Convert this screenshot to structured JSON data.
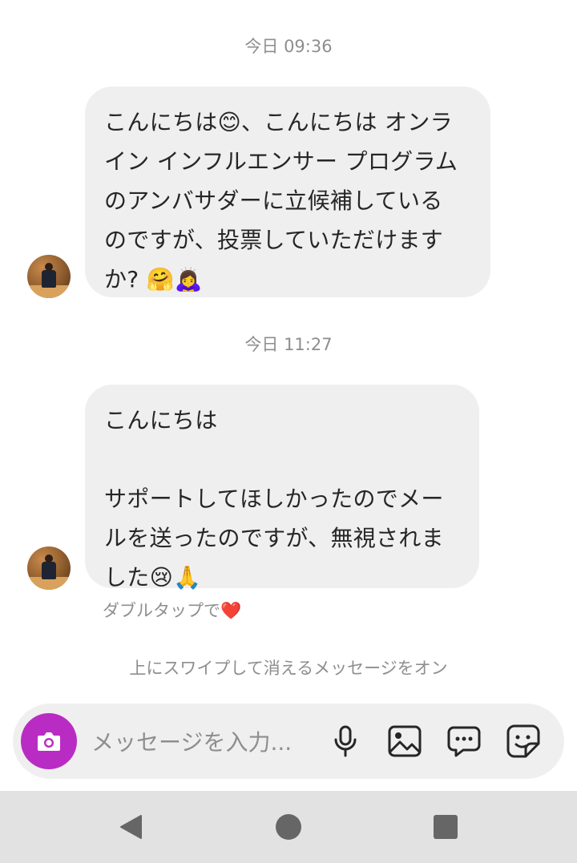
{
  "conversation": {
    "timestamps": [
      "今日 09:36",
      "今日 11:27"
    ],
    "messages": [
      {
        "lines": [
          "こんにちは😊、こんにちは オンラ",
          "イン インフルエンサー プログラム",
          "のアンバサダーに立候補している",
          "のですが、投票していただけます",
          "か? 🤗🙇‍♀️"
        ]
      },
      {
        "lines": [
          "こんにちは",
          "",
          "サポートしてほしかったのでメー",
          "ルを送ったのですが、無視されま",
          "した😢🙏"
        ]
      }
    ],
    "double_tap_hint": "ダブルタップで❤️",
    "vanish_mode_hint": "上にスワイプして消えるメッセージをオン"
  },
  "composer": {
    "placeholder": "メッセージを入力...",
    "icons": [
      "camera-icon",
      "microphone-icon",
      "gallery-icon",
      "chat-bubble-icon",
      "sticker-icon"
    ]
  },
  "navbar": {
    "icons": [
      "back-icon",
      "home-icon",
      "recents-icon"
    ]
  },
  "colors": {
    "bubble": "#efefef",
    "camera_button": "#b92cc4",
    "secondary_text": "#8e8e8e",
    "navbar": "#e2e2e2"
  }
}
